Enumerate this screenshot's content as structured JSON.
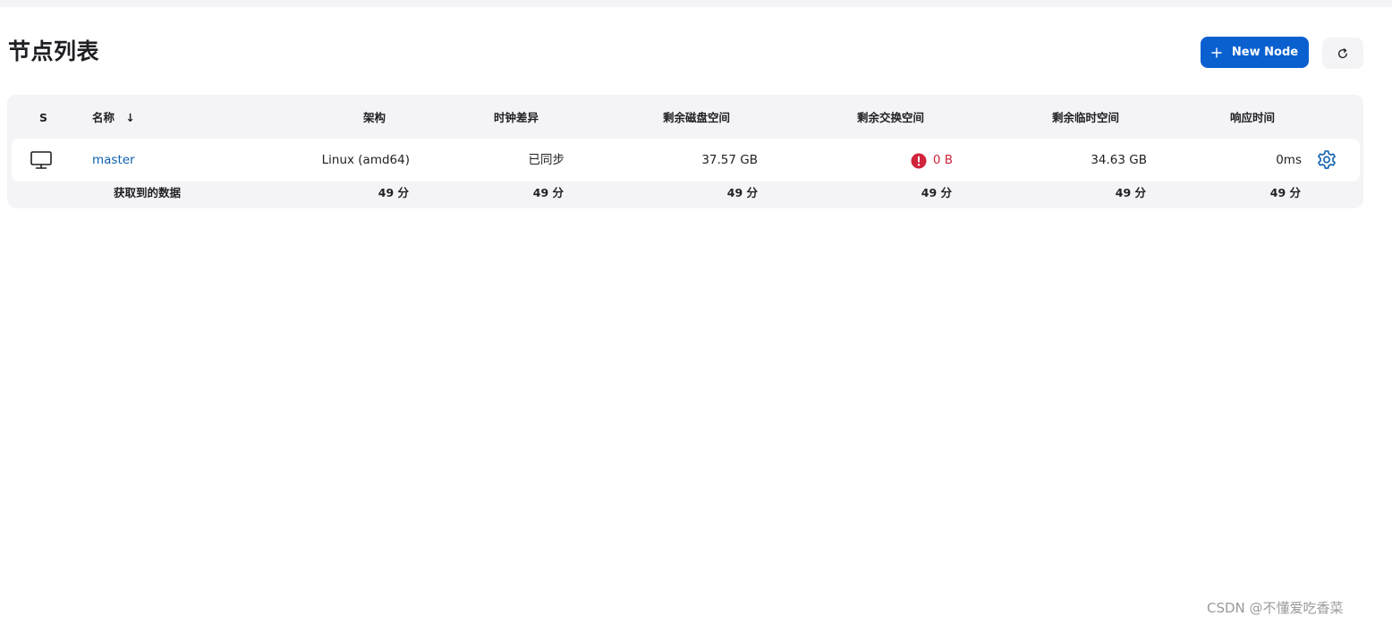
{
  "page": {
    "title": "节点列表",
    "new_node_label": "New Node",
    "accent_color": "#0b60d0",
    "warning_color": "#d0243c"
  },
  "table": {
    "headers": {
      "status": "S",
      "name": "名称",
      "sort_indicator": "↓",
      "arch": "架构",
      "clock": "时钟差异",
      "disk": "剩余磁盘空间",
      "swap": "剩余交换空间",
      "temp": "剩余临时空间",
      "response": "响应时间"
    },
    "rows": [
      {
        "icon": "computer-icon",
        "name": "master",
        "arch": "Linux (amd64)",
        "clock": "已同步",
        "disk": "37.57 GB",
        "swap": "0 B",
        "swap_icon": "error-icon",
        "temp": "34.63 GB",
        "response": "0ms",
        "action_icon": "gear-icon"
      }
    ],
    "footer": {
      "label": "获取到的数据",
      "arch": "49 分",
      "clock": "49 分",
      "disk": "49 分",
      "swap": "49 分",
      "temp": "49 分",
      "response": "49 分"
    }
  },
  "watermark": "CSDN @不懂爱吃香菜"
}
